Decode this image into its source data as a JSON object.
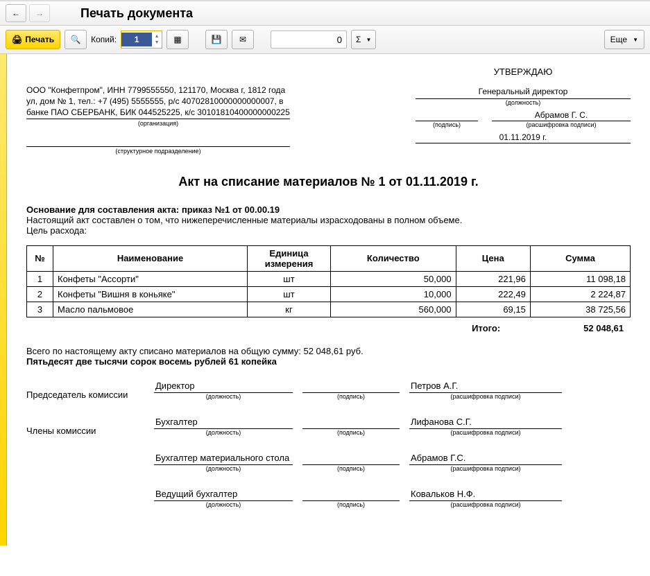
{
  "titlebar": {
    "title": "Печать документа"
  },
  "toolbar": {
    "print": "Печать",
    "copies_label": "Копий:",
    "copies_value": "1",
    "num_value": "0",
    "more": "Еще"
  },
  "header": {
    "org_text": "ООО \"Конфетпром\", ИНН 7799555550, 121170, Москва г, 1812 года ул, дом № 1, тел.: +7 (495) 5555555, р/с 40702810000000000007, в банке ПАО СБЕРБАНК, БИК 044525225, к/с 30101810400000000225",
    "org_sub": "(организация)",
    "dept_sub": "(структурное подразделение)",
    "approve_title": "УТВЕРЖДАЮ",
    "position": "Генеральный директор",
    "position_sub": "(должность)",
    "sign_sub": "(подпись)",
    "decipher": "Абрамов Г. С.",
    "decipher_sub": "(расшифровка подписи)",
    "date": "01.11.2019 г."
  },
  "main": {
    "title": "Акт на списание материалов № 1 от 01.11.2019 г.",
    "basis_label": "Основание для составления акта: приказ №1 от 00.00.19",
    "basis_text": "Настоящий акт составлен о том, что нижеперечисленные материалы израсходованы в полном объеме.",
    "purpose_label": "Цель расхода:"
  },
  "table": {
    "headers": {
      "n": "№",
      "name": "Наименование",
      "unit": "Единица измерения",
      "qty": "Количество",
      "price": "Цена",
      "sum": "Сумма"
    },
    "rows": [
      {
        "n": "1",
        "name": "Конфеты \"Ассорти\"",
        "unit": "шт",
        "qty": "50,000",
        "price": "221,96",
        "sum": "11 098,18"
      },
      {
        "n": "2",
        "name": "Конфеты \"Вишня в коньяке\"",
        "unit": "шт",
        "qty": "10,000",
        "price": "222,49",
        "sum": "2 224,87"
      },
      {
        "n": "3",
        "name": "Масло пальмовое",
        "unit": "кг",
        "qty": "560,000",
        "price": "69,15",
        "sum": "38 725,56"
      }
    ],
    "total_label": "Итого:",
    "total_sum": "52 048,61"
  },
  "footer": {
    "sum_text": "Всего по настоящему акту списано материалов на общую сумму: 52 048,61 руб.",
    "sum_words": "Пятьдесят две тысячи сорок восемь рублей 61 копейка",
    "job_sub": "(должность)",
    "sign_sub": "(подпись)",
    "name_sub": "(расшифровка подписи)",
    "chair_label": "Председатель комиссии",
    "members_label": "Члены комиссии",
    "rows": [
      {
        "role": "Председатель комиссии",
        "job": "Директор",
        "name": "Петров А.Г."
      },
      {
        "role": "Члены комиссии",
        "job": "Бухгалтер",
        "name": "Лифанова С.Г."
      },
      {
        "role": "",
        "job": "Бухгалтер материального стола",
        "name": "Абрамов Г.С."
      },
      {
        "role": "",
        "job": "Ведущий бухгалтер",
        "name": "Ковальков Н.Ф."
      }
    ]
  }
}
